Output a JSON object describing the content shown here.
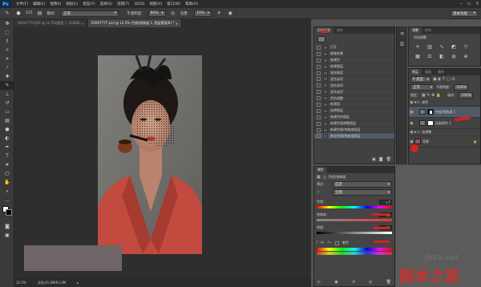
{
  "app": {
    "logo": "Ps",
    "menu": [
      "文件(F)",
      "编辑(E)",
      "图像(I)",
      "图层(L)",
      "类型(Y)",
      "选择(S)",
      "滤镜(T)",
      "3D(D)",
      "视图(V)",
      "窗口(W)",
      "帮助(H)"
    ]
  },
  "options": {
    "brush_size": "125",
    "mode_label": "模式：",
    "mode_value": "正常",
    "opacity_label": "不透明度：",
    "opacity_value": "80%",
    "flow_label": "流量：",
    "flow_value": "10%",
    "workspace": "基本功能"
  },
  "doc_tabs": [
    {
      "label": "2X0A7774.JPG @ 12.5%(图层 1, RGB/8)"
    },
    {
      "label": "2X0A7777.psd @ 12.5% (色相/饱和度 1, 图层蒙版/8) *"
    }
  ],
  "status": {
    "zoom": "12.5%",
    "doc": "文档:41.0M/63.3M"
  },
  "history": {
    "tabs": [
      "历史记录",
      "动作"
    ],
    "items": [
      "打开",
      "钢笔前景",
      "新建色",
      "新建图层",
      "填充图层",
      "混合选项",
      "混合选项",
      "混合选项",
      "色阶调整",
      "新建组",
      "选择图层",
      "新建色阶图层",
      "新建色相调整图层",
      "新建色相/饱和度图层",
      "移去色相/饱和度图层"
    ]
  },
  "adjustments": {
    "tabs": [
      "调整",
      "样式"
    ],
    "title": "添加调整"
  },
  "layers": {
    "tabs": [
      "图层",
      "通道",
      "路径"
    ],
    "kind": "P 类型",
    "blend": "正常",
    "opacity_label": "不透明度：",
    "opacity": "100%",
    "lock_label": "锁定：",
    "fill_label": "填充：",
    "fill": "100%",
    "items": [
      {
        "name": "调色",
        "type": "group"
      },
      {
        "name": "色相/饱和度 1",
        "type": "adjustment"
      },
      {
        "name": "选取颜色 1",
        "type": "adjustment"
      },
      {
        "name": "加调整",
        "type": "group"
      },
      {
        "name": "背景",
        "type": "image"
      }
    ]
  },
  "properties": {
    "tabs": [
      "属性"
    ],
    "title": "色相/饱和度",
    "preset_label": "预设：",
    "preset": "自定",
    "channel": "全图",
    "hue_label": "色相：",
    "hue": "+7",
    "saturation_label": "饱和度：",
    "saturation": "-43",
    "lightness_label": "明度：",
    "lightness": "-11",
    "colorize_label": "着色"
  },
  "watermark": {
    "site": "jb51.net",
    "name": "脚本之家"
  },
  "colors": {
    "accent_red": "#d32222",
    "panel": "#424242",
    "selected": "#505a66"
  }
}
